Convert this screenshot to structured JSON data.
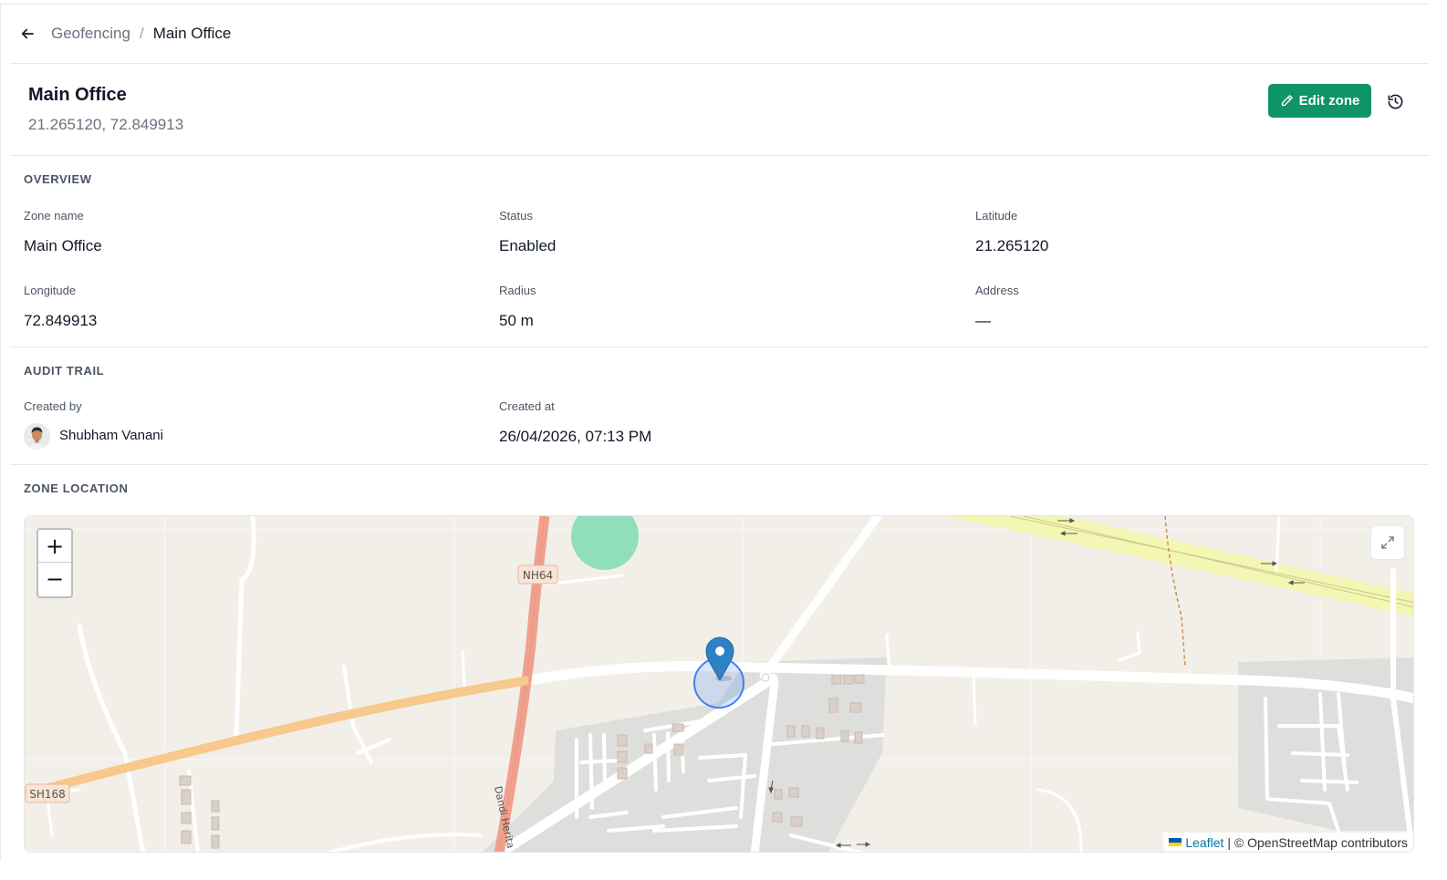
{
  "breadcrumb": {
    "parent": "Geofencing",
    "separator": "/",
    "current": "Main Office"
  },
  "header": {
    "title": "Main Office",
    "coordinates": "21.265120, 72.849913",
    "edit_label": "Edit zone",
    "accent_color": "#0f9466"
  },
  "overview": {
    "title": "OVERVIEW",
    "fields": [
      {
        "label": "Zone name",
        "value": "Main Office"
      },
      {
        "label": "Status",
        "value": "Enabled"
      },
      {
        "label": "Latitude",
        "value": "21.265120"
      },
      {
        "label": "Longitude",
        "value": "72.849913"
      },
      {
        "label": "Radius",
        "value": "50 m"
      },
      {
        "label": "Address",
        "value": "—"
      }
    ]
  },
  "audit": {
    "title": "AUDIT TRAIL",
    "created_by_label": "Created by",
    "created_by": "Shubham Vanani",
    "created_at_label": "Created at",
    "created_at": "26/04/2026, 07:13 PM"
  },
  "location": {
    "title": "ZONE LOCATION",
    "map": {
      "zoom_in": "+",
      "zoom_out": "−",
      "road_labels": [
        "NH64",
        "SH168",
        "Dandi Herita"
      ],
      "attribution_leaflet": "Leaflet",
      "attribution_rest": "| © OpenStreetMap contributors",
      "marker_icon": "map-pin-icon",
      "radius_color": "#3b82f6"
    }
  }
}
